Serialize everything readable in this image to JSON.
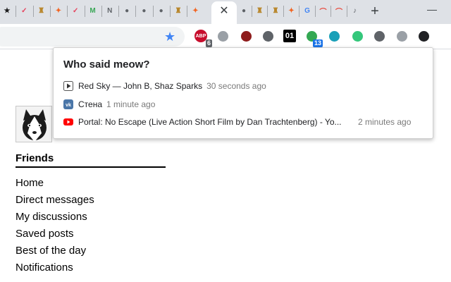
{
  "browser": {
    "tabs": [
      {
        "icon": "black-star-favicon-icon",
        "color": "#1a1a1a"
      },
      {
        "icon": "checkmark-favicon-icon",
        "color": "#e6405a"
      },
      {
        "icon": "porsche-crest-favicon-icon",
        "color": "#b8862b"
      },
      {
        "icon": "fire-logo-favicon-icon",
        "color": "#f26522"
      },
      {
        "icon": "checkmark-favicon-icon",
        "color": "#e6405a"
      },
      {
        "icon": "green-m-favicon-icon",
        "color": "#3aa757"
      },
      {
        "icon": "n-favicon-icon",
        "color": "#5f6368"
      },
      {
        "icon": "globe-favicon-icon",
        "color": "#5f6368"
      },
      {
        "icon": "globe-favicon-icon",
        "color": "#5f6368"
      },
      {
        "icon": "globe-favicon-icon",
        "color": "#5f6368"
      },
      {
        "icon": "porsche-crest-favicon-icon",
        "color": "#b8862b"
      },
      {
        "icon": "fire-logo-favicon-icon",
        "color": "#f26522"
      }
    ],
    "tabs_after": [
      {
        "icon": "globe-favicon-icon",
        "color": "#5f6368"
      },
      {
        "icon": "porsche-crest-favicon-icon",
        "color": "#b8862b"
      },
      {
        "icon": "porsche-crest-favicon-icon",
        "color": "#b8862b"
      },
      {
        "icon": "fire-logo-favicon-icon",
        "color": "#f26522"
      },
      {
        "icon": "google-favicon-icon",
        "color": "#4285f4"
      },
      {
        "icon": "rainbow-favicon-icon",
        "color": "#e94335"
      },
      {
        "icon": "rainbow-favicon-icon",
        "color": "#e94335"
      },
      {
        "icon": "speaker-icon",
        "color": "#5f6368"
      }
    ],
    "close_glyph": "✕",
    "new_tab_glyph": "+",
    "minimize_glyph": "—",
    "bookmark_star_glyph": "★"
  },
  "extensions": [
    {
      "name": "adblock-extension-icon",
      "label": "ABP",
      "badge": "6",
      "color": "#c70d2c"
    },
    {
      "name": "google-drive-extension-icon",
      "label": "",
      "badge": "",
      "color": "#9aa0a6"
    },
    {
      "name": "red-shield-extension-icon",
      "label": "",
      "badge": "",
      "color": "#8e1c1c"
    },
    {
      "name": "gear-extension-icon",
      "label": "",
      "badge": "",
      "color": "#5f6368"
    },
    {
      "name": "o1-extension-icon",
      "label": "01",
      "badge": "",
      "color": "#000000"
    },
    {
      "name": "colorful-globe-extension-icon",
      "label": "",
      "badge": "13",
      "color": "#34a853"
    },
    {
      "name": "react-extension-icon",
      "label": "",
      "badge": "",
      "color": "#1aa0b8"
    },
    {
      "name": "green-ring-extension-icon",
      "label": "",
      "badge": "",
      "color": "#34c77b"
    },
    {
      "name": "shield-extension-icon",
      "label": "",
      "badge": "",
      "color": "#5f6368"
    },
    {
      "name": "camera-extension-icon",
      "label": "",
      "badge": "",
      "color": "#9aa0a6"
    },
    {
      "name": "cat-face-extension-icon",
      "label": "",
      "badge": "",
      "color": "#202124"
    }
  ],
  "popup": {
    "title": "Who said meow?",
    "rows": [
      {
        "icon": "play-icon",
        "text": "Red Sky — John B, Shaz Sparks",
        "time": "30 seconds ago"
      },
      {
        "icon": "vk-icon",
        "text": "Стена",
        "time": "1 minute ago"
      },
      {
        "icon": "youtube-icon",
        "text": "Portal: No Escape (Live Action Short Film by Dan Trachtenberg) - Yo...",
        "time": "2 minutes ago"
      }
    ]
  },
  "page": {
    "section_title": "Friends",
    "menu": [
      "Home",
      "Direct messages",
      "My discussions",
      "Saved posts",
      "Best of the day",
      "Notifications"
    ]
  },
  "colors": {
    "tabstrip": "#dee1e6",
    "youtube_red": "#ff0000",
    "vk_blue": "#4a76a8",
    "star_blue": "#4285f4"
  }
}
